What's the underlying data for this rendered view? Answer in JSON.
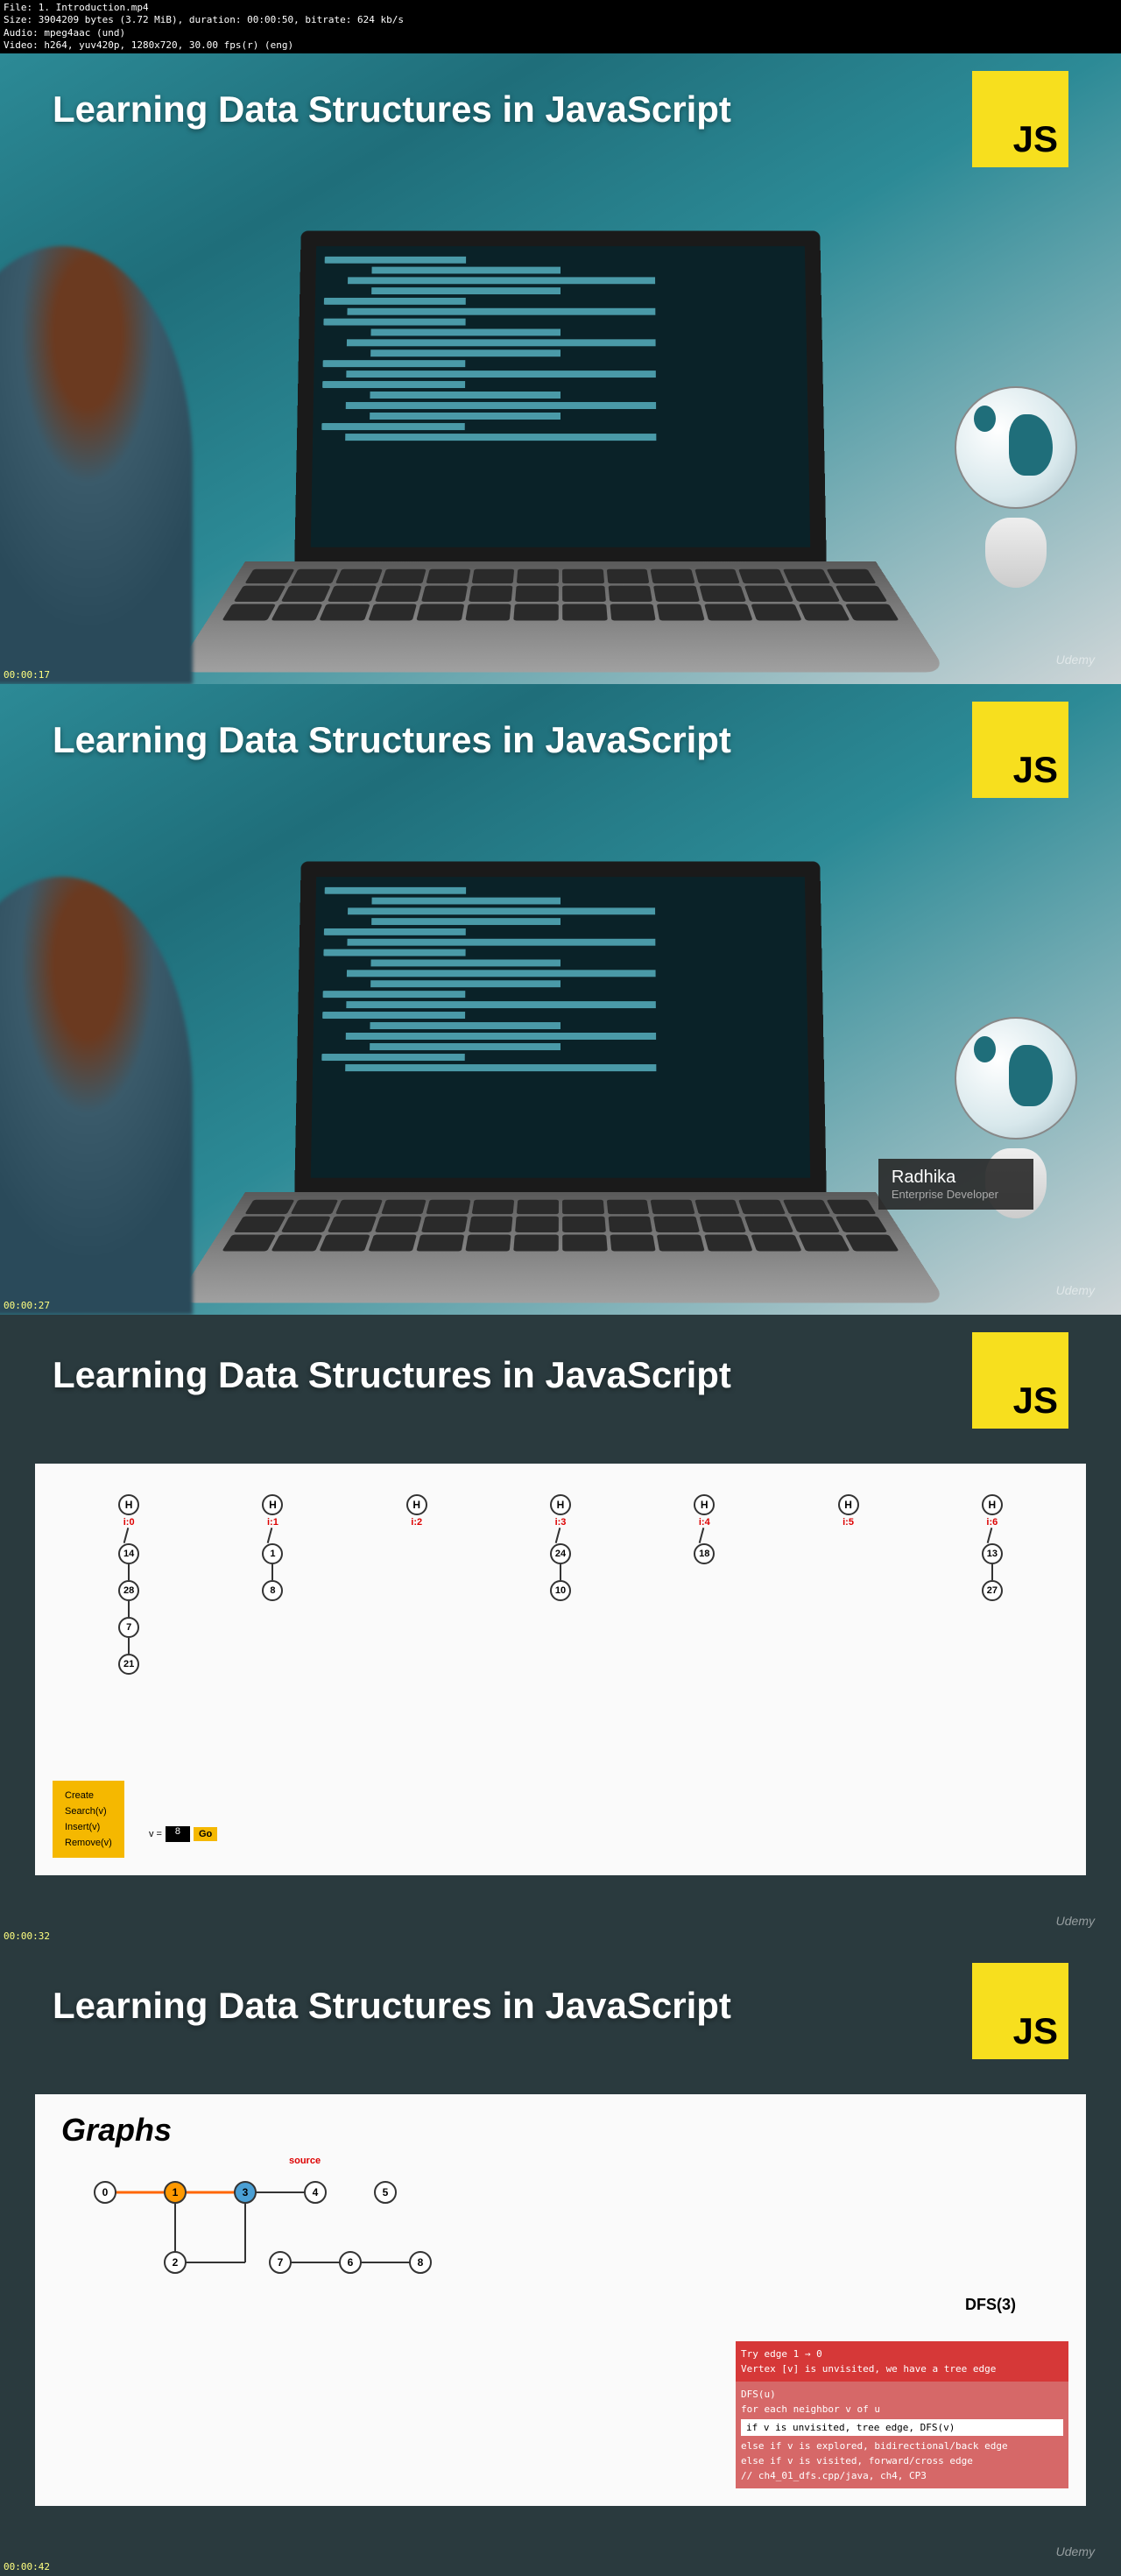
{
  "info": {
    "file": "File: 1. Introduction.mp4",
    "size": "Size: 3904209 bytes (3.72 MiB), duration: 00:00:50, bitrate: 624 kb/s",
    "audio": "Audio: mpeg4aac (und)",
    "video": "Video: h264, yuv420p, 1280x720, 30.00 fps(r) (eng)"
  },
  "title": "Learning Data Structures in JavaScript",
  "js_badge": "JS",
  "udemy": "Udemy",
  "frames": {
    "f1": {
      "ts": "00:00:17"
    },
    "f2": {
      "ts": "00:00:27",
      "name": "Radhika",
      "role": "Enterprise Developer"
    },
    "f3": {
      "ts": "00:00:32"
    },
    "f4": {
      "ts": "00:00:42"
    }
  },
  "hash_table": {
    "columns": [
      {
        "idx": "i:0",
        "chain": [
          "14",
          "28",
          "7",
          "21"
        ]
      },
      {
        "idx": "i:1",
        "chain": [
          "1",
          "8"
        ]
      },
      {
        "idx": "i:2",
        "chain": []
      },
      {
        "idx": "i:3",
        "chain": [
          "24",
          "10"
        ]
      },
      {
        "idx": "i:4",
        "chain": [
          "18"
        ]
      },
      {
        "idx": "i:5",
        "chain": []
      },
      {
        "idx": "i:6",
        "chain": [
          "13",
          "27"
        ]
      }
    ],
    "head": "H",
    "menu": [
      "Create",
      "Search(v)",
      "Insert(v)",
      "Remove(v)"
    ],
    "input_label": "v =",
    "input_value": "8",
    "go": "Go"
  },
  "graphs": {
    "heading": "Graphs",
    "source_label": "source",
    "dfs_label": "DFS(3)",
    "nodes": [
      "0",
      "1",
      "2",
      "3",
      "4",
      "5",
      "6",
      "7",
      "8"
    ],
    "pseudo_head": [
      "Try edge 1 → 0",
      "Vertex [v] is unvisited, we have a tree edge"
    ],
    "pseudo_body_title": "DFS(u)",
    "pseudo_lines": [
      "for each neighbor v of u",
      "if v is unvisited, tree edge, DFS(v)",
      "else if v is explored, bidirectional/back edge",
      "else if v is visited, forward/cross edge",
      "// ch4_01_dfs.cpp/java, ch4, CP3"
    ]
  }
}
